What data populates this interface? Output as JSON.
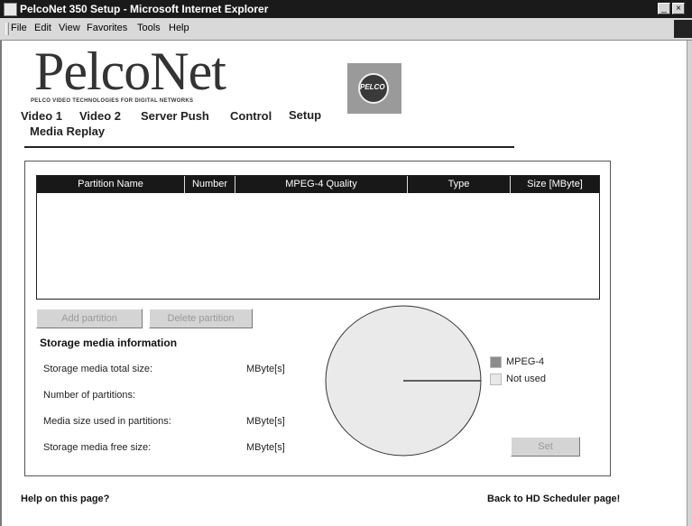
{
  "window": {
    "title": "PelcoNet 350 Setup - Microsoft Internet Explorer",
    "controls": [
      "_",
      "×"
    ]
  },
  "menu": {
    "items": [
      {
        "label": "File"
      },
      {
        "label": "Edit"
      },
      {
        "label": "View"
      },
      {
        "label": "Favorites"
      },
      {
        "label": "Tools"
      },
      {
        "label": "Help"
      }
    ]
  },
  "branding": {
    "logo_text": "PelcoNet",
    "tagline": "PELCO VIDEO TECHNOLOGIES FOR DIGITAL NETWORKS",
    "badge_text": "PELCO"
  },
  "nav": {
    "items": [
      {
        "label": "Video 1"
      },
      {
        "label": "Video 2"
      },
      {
        "label": "Server Push"
      },
      {
        "label": "Control"
      },
      {
        "label": "Setup"
      },
      {
        "label": "Media Replay"
      }
    ]
  },
  "partition_table": {
    "columns": [
      "Partition Name",
      "Number",
      "MPEG-4 Quality",
      "Type",
      "Size [MByte]"
    ],
    "rows": []
  },
  "buttons": {
    "add_partition": "Add partition",
    "delete_partition": "Delete partition",
    "set": "Set"
  },
  "storage_info": {
    "heading": "Storage media information",
    "rows": [
      {
        "label": "Storage media total size:",
        "unit": "MByte[s]"
      },
      {
        "label": "Number of partitions:",
        "unit": ""
      },
      {
        "label": "Media size used in partitions:",
        "unit": "MByte[s]"
      },
      {
        "label": "Storage media free size:",
        "unit": "MByte[s]"
      }
    ]
  },
  "legend": {
    "items": [
      {
        "label": "MPEG-4",
        "color": "#8c8c8c"
      },
      {
        "label": "Not used",
        "color": "#e8e8e8"
      }
    ]
  },
  "pie": {
    "fill": "#eaeaea",
    "stroke": "#333333"
  },
  "footer": {
    "help_link": "Help on this page?",
    "back_link": "Back to HD Scheduler page!"
  }
}
